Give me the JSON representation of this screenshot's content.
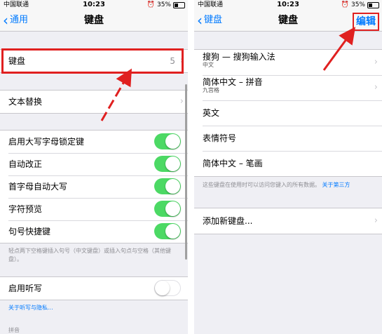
{
  "left": {
    "status": {
      "carrier": "中国联通",
      "time": "10:23",
      "battery": "35%",
      "battery_level": 0.35
    },
    "nav": {
      "back_label": "通用",
      "title": "键盘"
    },
    "group1": {
      "keyboard_label": "键盘",
      "keyboard_count": "5"
    },
    "group2": {
      "text_replace_label": "文本替换"
    },
    "group3": {
      "items": [
        {
          "label": "启用大写字母锁定键",
          "on": true
        },
        {
          "label": "自动改正",
          "on": true
        },
        {
          "label": "首字母自动大写",
          "on": true
        },
        {
          "label": "字符预览",
          "on": true
        },
        {
          "label": "句号快捷键",
          "on": true
        }
      ],
      "footer": "轻点两下空格键插入句号（中文键盘）或插入句点与空格（其他键盘）。"
    },
    "group4": {
      "dictation_label": "启用听写",
      "dictation_on": false,
      "link": "关于听写与隐私..."
    },
    "section_header": "拼音"
  },
  "right": {
    "status": {
      "carrier": "中国联通",
      "time": "10:23",
      "battery": "35%",
      "battery_level": 0.35
    },
    "nav": {
      "back_label": "键盘",
      "title": "键盘",
      "edit_label": "编辑"
    },
    "keyboards": [
      {
        "label": "搜狗 — 搜狗输入法",
        "sub": "中文"
      },
      {
        "label": "简体中文 – 拼音",
        "sub": "九宫格"
      },
      {
        "label": "英文",
        "sub": ""
      },
      {
        "label": "表情符号",
        "sub": ""
      },
      {
        "label": "简体中文 – 笔画",
        "sub": ""
      }
    ],
    "footer_text": "这些键盘在使用时可以访问您键入的所有数据。",
    "footer_link": "关于第三方",
    "add_keyboard": "添加新键盘..."
  },
  "colors": {
    "accent": "#007aff",
    "switch_on": "#4cd964",
    "highlight": "#e02020",
    "background": "#efeff4"
  }
}
